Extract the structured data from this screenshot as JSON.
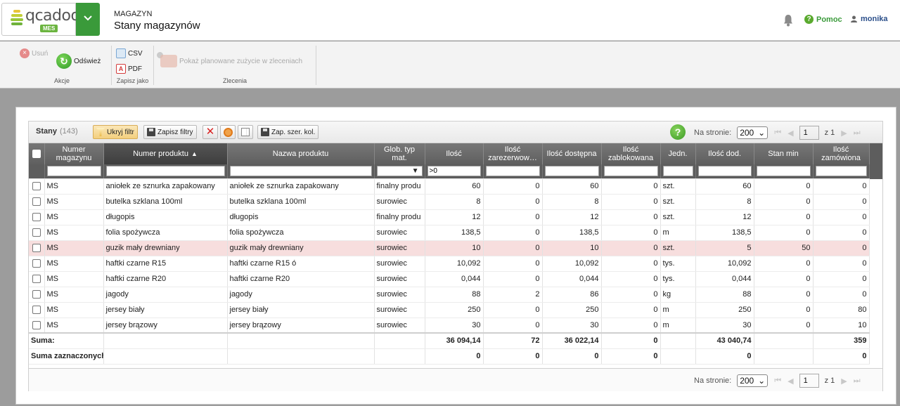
{
  "header": {
    "logo_text": "qcadoo",
    "logo_badge": "MES",
    "breadcrumb_parent": "MAGAZYN",
    "page_title": "Stany magazynów",
    "help_label": "Pomoc",
    "user_name": "monika"
  },
  "ribbon": {
    "delete_label": "Usuń",
    "refresh_label": "Odśwież",
    "group_actions": "Akcje",
    "csv_label": "CSV",
    "pdf_label": "PDF",
    "group_save": "Zapisz jako",
    "plan_label": "Pokaż planowane zużycie w zleceniach",
    "group_orders": "Zlecenia"
  },
  "grid": {
    "title": "Stany",
    "count": "(143)",
    "hide_filter": "Ukryj filtr",
    "save_filters": "Zapisz filtry",
    "save_col_width": "Zap. szer. kol.",
    "per_page_label": "Na stronie:",
    "per_page_value": "200",
    "page_value": "1",
    "page_of": "z 1",
    "columns": [
      "Numer magazynu",
      "Numer produktu",
      "Nazwa produktu",
      "Glob. typ mat.",
      "Ilość",
      "Ilość zarezerwow…",
      "Ilość dostępna",
      "Ilość zablokowana",
      "Jedn.",
      "Ilość dod.",
      "Stan min",
      "Ilość zamówiona"
    ],
    "filter_quantity": ">0",
    "rows": [
      {
        "mag": "MS",
        "num": "aniołek ze sznurka zapakowany",
        "name": "aniołek ze sznurka zapakowany",
        "type": "finalny produ",
        "qty": "60",
        "res": "0",
        "avail": "60",
        "blocked": "0",
        "unit": "szt.",
        "qty_add": "60",
        "min": "0",
        "ordered": "0",
        "warn": false
      },
      {
        "mag": "MS",
        "num": "butelka szklana 100ml",
        "name": "butelka szklana 100ml",
        "type": "surowiec",
        "qty": "8",
        "res": "0",
        "avail": "8",
        "blocked": "0",
        "unit": "szt.",
        "qty_add": "8",
        "min": "0",
        "ordered": "0",
        "warn": false
      },
      {
        "mag": "MS",
        "num": "długopis",
        "name": "długopis",
        "type": "finalny produ",
        "qty": "12",
        "res": "0",
        "avail": "12",
        "blocked": "0",
        "unit": "szt.",
        "qty_add": "12",
        "min": "0",
        "ordered": "0",
        "warn": false
      },
      {
        "mag": "MS",
        "num": "folia spożywcza",
        "name": "folia spożywcza",
        "type": "surowiec",
        "qty": "138,5",
        "res": "0",
        "avail": "138,5",
        "blocked": "0",
        "unit": "m",
        "qty_add": "138,5",
        "min": "0",
        "ordered": "0",
        "warn": false
      },
      {
        "mag": "MS",
        "num": "guzik mały drewniany",
        "name": "guzik mały drewniany",
        "type": "surowiec",
        "qty": "10",
        "res": "0",
        "avail": "10",
        "blocked": "0",
        "unit": "szt.",
        "qty_add": "5",
        "min": "50",
        "ordered": "0",
        "warn": true
      },
      {
        "mag": "MS",
        "num": "haftki czarne R15",
        "name": "haftki czarne R15 ó",
        "type": "surowiec",
        "qty": "10,092",
        "res": "0",
        "avail": "10,092",
        "blocked": "0",
        "unit": "tys.",
        "qty_add": "10,092",
        "min": "0",
        "ordered": "0",
        "warn": false
      },
      {
        "mag": "MS",
        "num": "haftki czarne R20",
        "name": "haftki czarne R20",
        "type": "surowiec",
        "qty": "0,044",
        "res": "0",
        "avail": "0,044",
        "blocked": "0",
        "unit": "tys.",
        "qty_add": "0,044",
        "min": "0",
        "ordered": "0",
        "warn": false
      },
      {
        "mag": "MS",
        "num": "jagody",
        "name": "jagody",
        "type": "surowiec",
        "qty": "88",
        "res": "2",
        "avail": "86",
        "blocked": "0",
        "unit": "kg",
        "qty_add": "88",
        "min": "0",
        "ordered": "0",
        "warn": false
      },
      {
        "mag": "MS",
        "num": "jersey biały",
        "name": "jersey biały",
        "type": "surowiec",
        "qty": "250",
        "res": "0",
        "avail": "250",
        "blocked": "0",
        "unit": "m",
        "qty_add": "250",
        "min": "0",
        "ordered": "80",
        "warn": false
      },
      {
        "mag": "MS",
        "num": "jersey brązowy",
        "name": "jersey brązowy",
        "type": "surowiec",
        "qty": "30",
        "res": "0",
        "avail": "30",
        "blocked": "0",
        "unit": "m",
        "qty_add": "30",
        "min": "0",
        "ordered": "10",
        "warn": false
      }
    ],
    "sum": {
      "label": "Suma:",
      "qty": "36 094,14",
      "res": "72",
      "avail": "36 022,14",
      "blocked": "0",
      "qty_add": "43 040,74",
      "ordered": "359"
    },
    "sum_selected": {
      "label": "Suma zaznaczonych:",
      "qty": "0",
      "res": "0",
      "avail": "0",
      "blocked": "0",
      "qty_add": "0",
      "ordered": "0"
    }
  }
}
